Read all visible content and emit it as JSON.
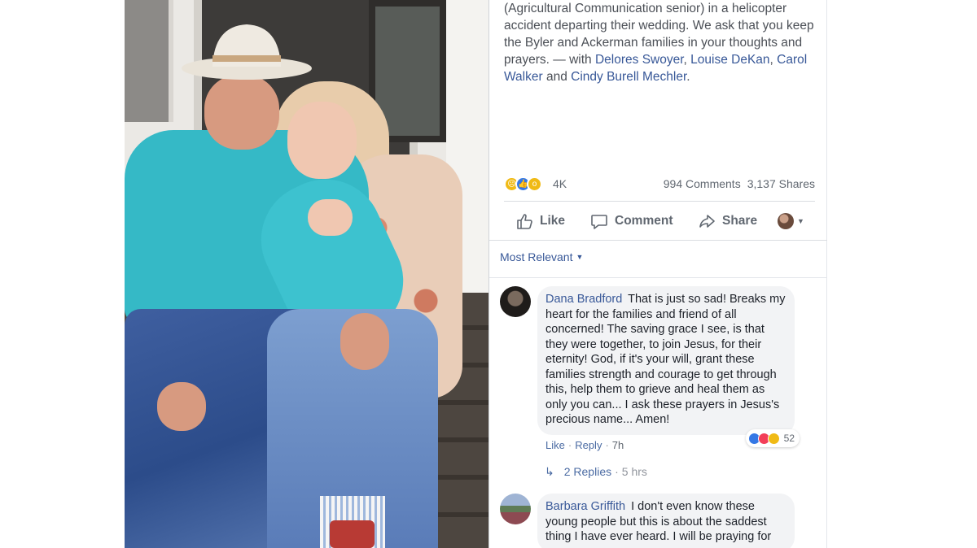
{
  "post": {
    "text_plain": "(Agricultural Communication senior) in a helicopter accident departing their wedding. We ask that you keep the Byler and Ackerman families in your thoughts and prayers. — with ",
    "tagged": [
      "Delores Swoyer",
      "Louise DeKan",
      "Carol Walker",
      "Cindy Burell Mechler"
    ],
    "tag_sep1": ", ",
    "tag_sep2": ", ",
    "tag_and": " and ",
    "tag_end": ".",
    "reaction_count": "4K",
    "comments_count": "994 Comments",
    "shares_count": "3,137 Shares",
    "reaction_icons": [
      "sad-icon",
      "like-icon",
      "wow-icon"
    ]
  },
  "actions": {
    "like": "Like",
    "comment": "Comment",
    "share": "Share"
  },
  "sort": {
    "label": "Most Relevant"
  },
  "comments": [
    {
      "author": "Dana Bradford",
      "text": "That is just so sad! Breaks my heart for the families and friend of all concerned! The saving grace I see, is that they were together, to join Jesus, for their eternity! God, if it's your will, grant these families strength and courage to get through this, help them to grieve and heal them as only you can... I ask these prayers in Jesus's precious name... Amen!",
      "like_label": "Like",
      "reply_label": "Reply",
      "time": "7h",
      "reaction_count": "52",
      "replies_label": "2 Replies",
      "replies_time": "5 hrs"
    },
    {
      "author": "Barbara Griffith",
      "text": "I don't even know these young people but this is about the saddest thing I have ever heard. I will be praying for"
    }
  ],
  "colors": {
    "link": "#385898",
    "meta": "#606770",
    "bubble": "#f2f3f5",
    "shirt": "#35b9c6"
  }
}
